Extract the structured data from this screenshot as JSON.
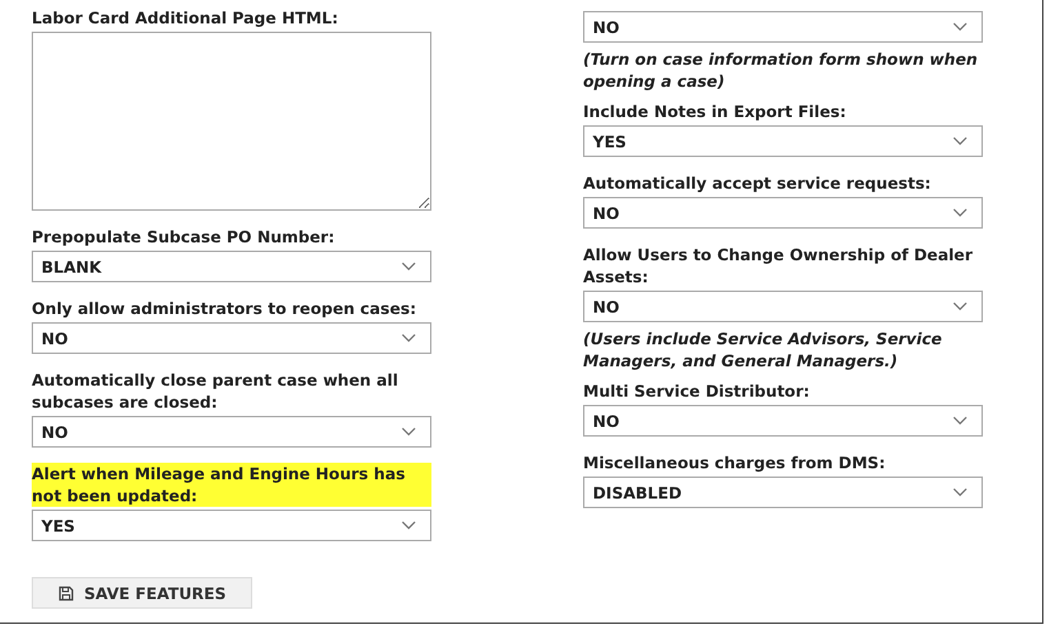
{
  "left_fields": [
    {
      "kind": "textarea",
      "label": "Labor Card Additional Page HTML:",
      "highlighted": false
    },
    {
      "kind": "select",
      "label": "Prepopulate Subcase PO Number:",
      "value": "BLANK",
      "highlighted": false
    },
    {
      "kind": "select",
      "label": "Only allow administrators to reopen cases:",
      "value": "NO",
      "highlighted": false
    },
    {
      "kind": "select",
      "label": "Automatically close parent case when all subcases are closed:",
      "value": "NO",
      "highlighted": false
    },
    {
      "kind": "select",
      "label": "Alert when Mileage and Engine Hours has not been updated:",
      "value": "YES",
      "highlighted": true
    }
  ],
  "save_button": {
    "label": "SAVE FEATURES"
  },
  "right_fields": [
    {
      "kind": "select",
      "value": "NO",
      "note": "(Turn on case information form shown when opening a case)"
    },
    {
      "kind": "select",
      "label": "Include Notes in Export Files:",
      "value": "YES"
    },
    {
      "kind": "select",
      "label": "Automatically accept service requests:",
      "value": "NO"
    },
    {
      "kind": "select",
      "label": "Allow Users to Change Ownership of Dealer Assets:",
      "value": "NO",
      "note": "(Users include Service Advisors, Service Managers, and General Managers.)"
    },
    {
      "kind": "select",
      "label": "Multi Service Distributor:",
      "value": "NO"
    },
    {
      "kind": "select",
      "label": "Miscellaneous charges from DMS:",
      "value": "DISABLED"
    }
  ]
}
